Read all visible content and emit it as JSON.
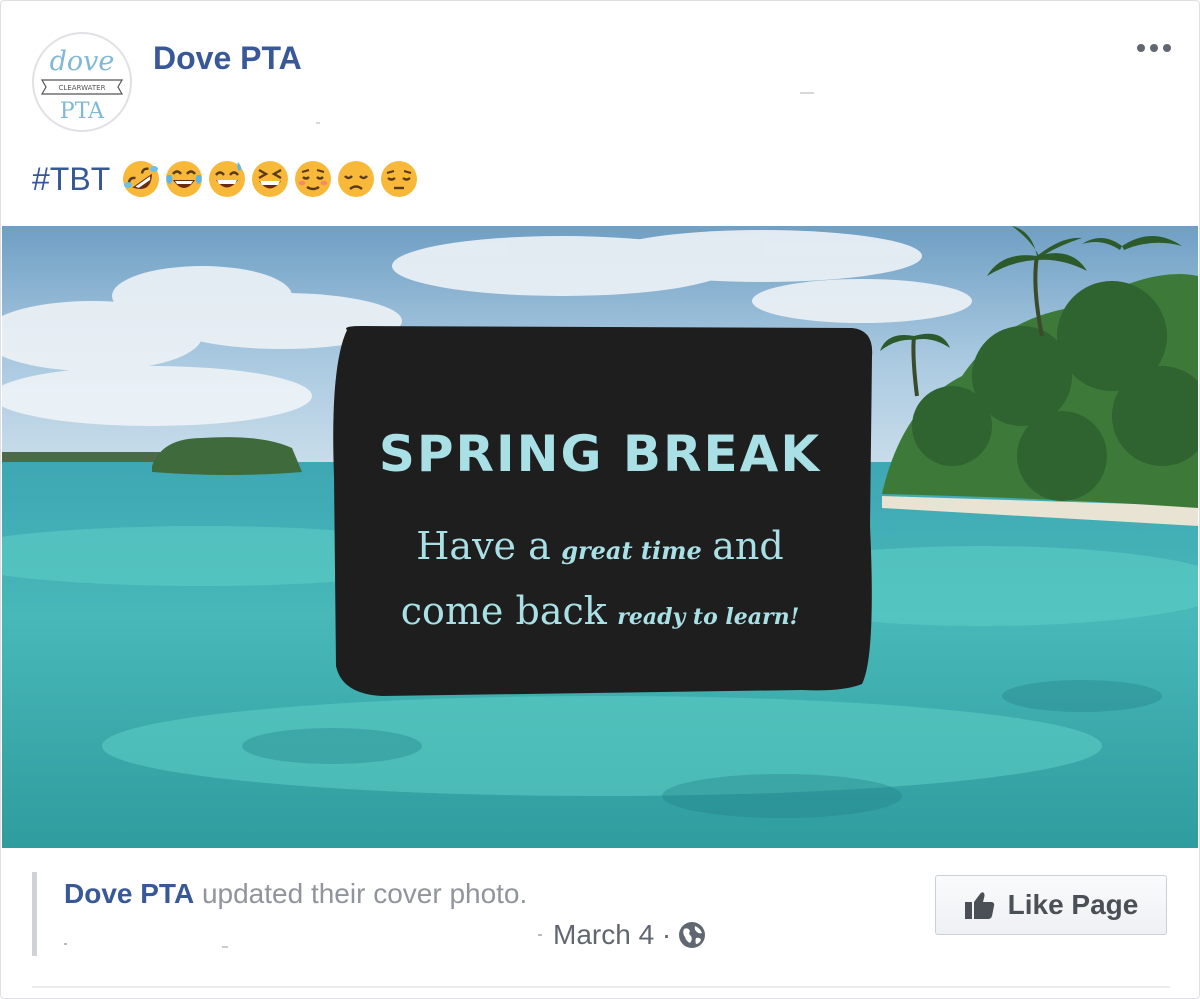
{
  "post": {
    "page_name": "Dove PTA",
    "avatar": {
      "top_text": "dove",
      "banner_text": "CLEARWATER",
      "bottom_text": "PTA"
    },
    "text": {
      "hashtag": "#TBT"
    },
    "emojis": [
      "rolling-on-floor-laughing",
      "face-with-tears-of-joy",
      "grinning-face-with-sweat",
      "grinning-squinting-face",
      "relieved-face",
      "disappointed-face",
      "pensive-face"
    ],
    "photo": {
      "headline": "SPRING BREAK",
      "line1_a": "Have a",
      "line1_b": "great time",
      "line1_c": "and",
      "line2_a": "come back",
      "line2_b": "ready to learn!"
    },
    "attachment": {
      "author": "Dove PTA",
      "action": " updated their cover photo.",
      "date": "March 4 ·"
    },
    "like_button": {
      "label": "Like Page"
    }
  },
  "colors": {
    "link": "#385898",
    "muted": "#90949c",
    "button_text": "#4b4f56",
    "sign": "#1e1e1e",
    "sign_text": "#a9e0e6"
  }
}
